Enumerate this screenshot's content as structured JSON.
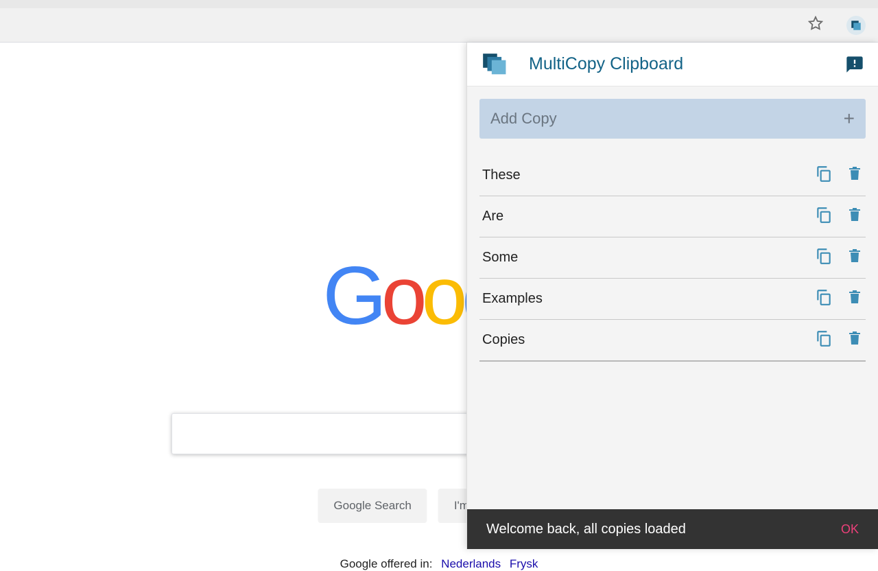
{
  "google": {
    "search_button": "Google Search",
    "lucky_button": "I'm Feeling Lucky",
    "offered_label": "Google offered in:",
    "lang1": "Nederlands",
    "lang2": "Frysk"
  },
  "ext": {
    "title": "MultiCopy Clipboard",
    "add_placeholder": "Add Copy",
    "items": [
      {
        "text": "These"
      },
      {
        "text": "Are"
      },
      {
        "text": "Some"
      },
      {
        "text": "Examples"
      },
      {
        "text": "Copies"
      }
    ],
    "footer_msg": "Welcome back, all copies loaded",
    "footer_ok": "OK"
  },
  "colors": {
    "brand": "#136387",
    "icon_blue": "#4b9fc6"
  }
}
